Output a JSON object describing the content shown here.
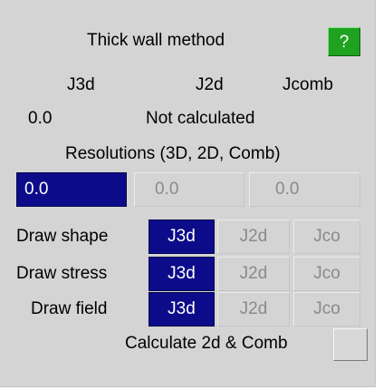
{
  "header": {
    "title": "Thick wall method",
    "help_label": "?"
  },
  "columns": [
    "J3d",
    "J2d",
    "Jcomb"
  ],
  "values": {
    "j3d": "0.0",
    "j2d": "Not calculated"
  },
  "resolutions": {
    "label": "Resolutions (3D, 2D, Comb)",
    "fields": [
      "0.0",
      "0.0",
      "0.0"
    ]
  },
  "draw_rows": [
    {
      "label": "Draw shape",
      "options": [
        "J3d",
        "J2d",
        "Jco"
      ],
      "selected": "J3d"
    },
    {
      "label": "Draw stress",
      "options": [
        "J3d",
        "J2d",
        "Jco"
      ],
      "selected": "J3d"
    },
    {
      "label": "Draw field",
      "options": [
        "J3d",
        "J2d",
        "Jco"
      ],
      "selected": "J3d"
    }
  ],
  "calculate": {
    "label": "Calculate 2d & Comb"
  },
  "colors": {
    "panel_bg": "#d4d4d4",
    "selected_bg": "#0c0c8a",
    "help_green": "#1fa21f",
    "disabled_text": "#8a8a8a"
  }
}
